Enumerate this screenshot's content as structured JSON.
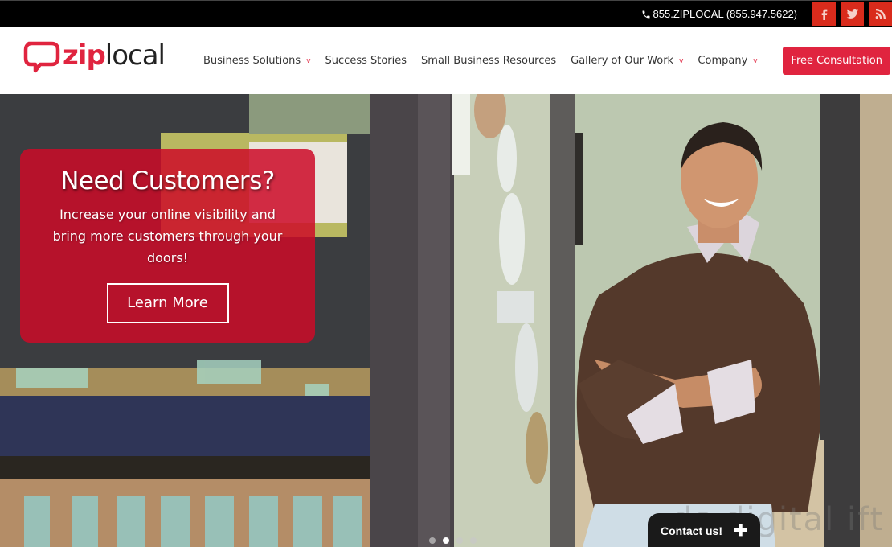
{
  "topbar": {
    "phone": "855.ZIPLOCAL (855.947.5622)",
    "phone_icon": "phone-icon",
    "social": [
      {
        "name": "facebook",
        "icon": "facebook-icon"
      },
      {
        "name": "twitter",
        "icon": "twitter-icon"
      },
      {
        "name": "rss",
        "icon": "rss-icon"
      }
    ],
    "social_color": "#d92b1c"
  },
  "header": {
    "logo": {
      "part1": "zip",
      "part2": "local"
    },
    "nav": [
      {
        "label": "Business Solutions",
        "has_dropdown": true
      },
      {
        "label": "Success Stories",
        "has_dropdown": false
      },
      {
        "label": "Small Business Resources",
        "has_dropdown": false
      },
      {
        "label": "Gallery of Our Work",
        "has_dropdown": true
      },
      {
        "label": "Company",
        "has_dropdown": true
      }
    ],
    "dropdown_glyph": "v",
    "cta": "Free Consultation",
    "brand_color": "#e0243f"
  },
  "hero": {
    "title": "Need Customers?",
    "text": "Increase your online visibility and bring more customers through your doors!",
    "button": "Learn More",
    "slides": 4,
    "active_slide": 2,
    "watermark": "ds  digital  ift"
  },
  "contact_widget": {
    "label": "Contact us!",
    "icon": "plus-icon"
  }
}
